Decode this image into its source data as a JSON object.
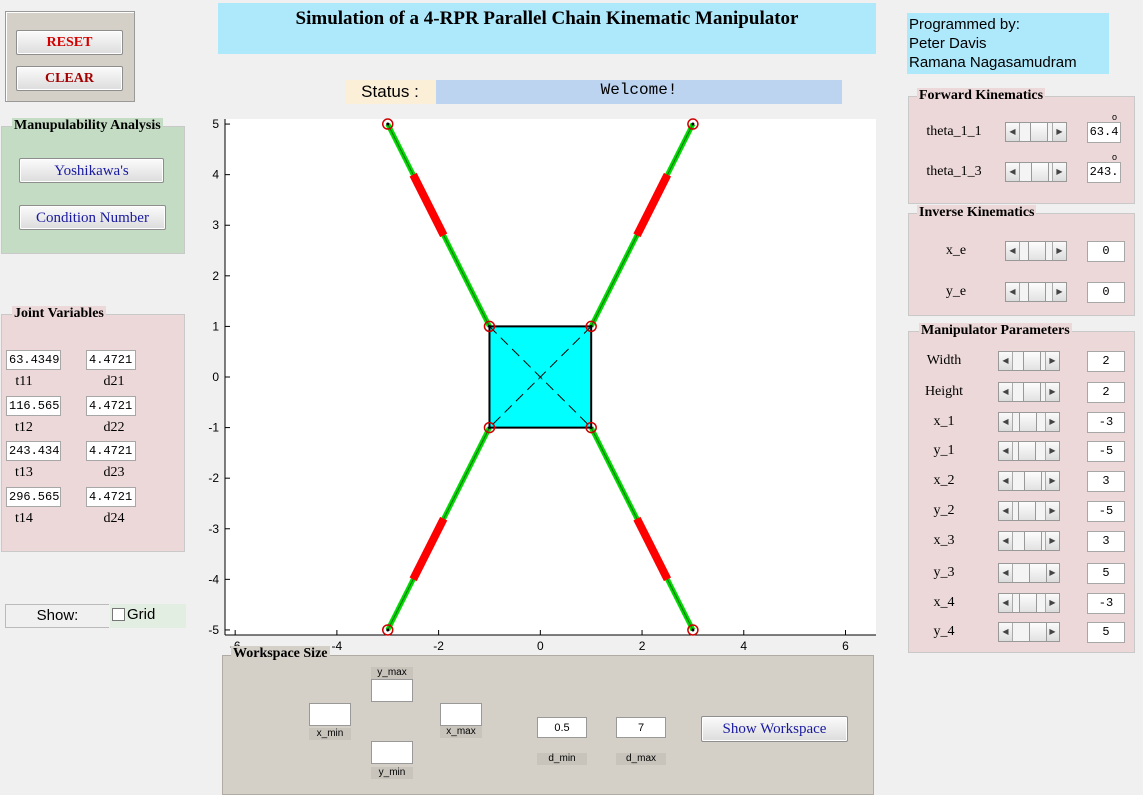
{
  "title": "Simulation of a 4-RPR Parallel Chain Kinematic Manipulator",
  "credits": [
    "Programmed by:",
    "Peter Davis",
    "Ramana Nagasamudram"
  ],
  "controls": {
    "reset": "RESET",
    "clear": "CLEAR"
  },
  "status": {
    "label": "Status :",
    "value": "Welcome!"
  },
  "manip_analysis": {
    "title": "Manupulability Analysis",
    "yoshikawa": "Yoshikawa's",
    "condition": "Condition Number"
  },
  "joint_vars": {
    "title": "Joint Variables",
    "rows": [
      {
        "t_val": "63.4349",
        "t_lbl": "t11",
        "d_val": "4.4721",
        "d_lbl": "d21"
      },
      {
        "t_val": "116.565",
        "t_lbl": "t12",
        "d_val": "4.4721",
        "d_lbl": "d22"
      },
      {
        "t_val": "243.434",
        "t_lbl": "t13",
        "d_val": "4.4721",
        "d_lbl": "d23"
      },
      {
        "t_val": "296.565",
        "t_lbl": "t14",
        "d_val": "4.4721",
        "d_lbl": "d24"
      }
    ]
  },
  "show": {
    "label": "Show:",
    "grid": "Grid",
    "grid_checked": false
  },
  "forward": {
    "title": "Forward Kinematics",
    "rows": [
      {
        "label": "theta_1_1",
        "value": "63.4",
        "unit": "o",
        "thumb": 0.55
      },
      {
        "label": "theta_1_3",
        "value": "243.",
        "unit": "o",
        "thumb": 0.6
      }
    ]
  },
  "inverse": {
    "title": "Inverse Kinematics",
    "rows": [
      {
        "label": "x_e",
        "value": "0",
        "thumb": 0.5
      },
      {
        "label": "y_e",
        "value": "0",
        "thumb": 0.5
      }
    ]
  },
  "params": {
    "title": "Manipulator Parameters",
    "rows": [
      {
        "label": "Width",
        "value": "2",
        "thumb": 0.55
      },
      {
        "label": "Height",
        "value": "2",
        "thumb": 0.55
      },
      {
        "label": "x_1",
        "value": "-3",
        "thumb": 0.45
      },
      {
        "label": "y_1",
        "value": "-5",
        "thumb": 0.4
      },
      {
        "label": "x_2",
        "value": "3",
        "thumb": 0.6
      },
      {
        "label": "y_2",
        "value": "-5",
        "thumb": 0.4
      },
      {
        "label": "x_3",
        "value": "3",
        "thumb": 0.6
      },
      {
        "label": "y_3",
        "value": "5",
        "thumb": 0.75
      },
      {
        "label": "x_4",
        "value": "-3",
        "thumb": 0.45
      },
      {
        "label": "y_4",
        "value": "5",
        "thumb": 0.75
      }
    ]
  },
  "workspace": {
    "title": "Workspace Size",
    "y_max": "y_max",
    "y_min": "y_min",
    "x_min": "x_min",
    "x_max": "x_max",
    "d_min": "d_min",
    "d_max": "d_max",
    "d_min_val": "0.5",
    "d_max_val": "7",
    "show_btn": "Show Workspace"
  },
  "colors": {
    "title_bg": "#aee8fb",
    "platform": "#00ffff",
    "link": "#00dd00",
    "actuator": "#ff0000",
    "joint": "#cc0000"
  },
  "plot": {
    "xlim": [
      -6.2,
      6.6
    ],
    "ylim": [
      -5.1,
      5.1
    ],
    "xticks": [
      -6,
      -4,
      -2,
      0,
      2,
      4,
      6
    ],
    "yticks": [
      5,
      4,
      3,
      2,
      1,
      0,
      -1,
      -2,
      -3,
      -4,
      -5
    ],
    "xtick_labels": [
      "-6",
      "-4",
      "-2",
      "0",
      "2",
      "4",
      "6"
    ],
    "ytick_labels": [
      "5",
      "4",
      "3",
      "2",
      "1",
      "0",
      "-1",
      "-2",
      "-3",
      "-4",
      "-5"
    ],
    "bases": [
      [
        -3,
        5
      ],
      [
        3,
        5
      ],
      [
        -3,
        -5
      ],
      [
        3,
        -5
      ]
    ],
    "platform": [
      [
        -1,
        1
      ],
      [
        1,
        1
      ],
      [
        1,
        -1
      ],
      [
        -1,
        -1
      ]
    ],
    "links": [
      {
        "base": [
          -3,
          5
        ],
        "end": [
          -1,
          1
        ]
      },
      {
        "base": [
          3,
          5
        ],
        "end": [
          1,
          1
        ]
      },
      {
        "base": [
          -3,
          -5
        ],
        "end": [
          -1,
          -1
        ]
      },
      {
        "base": [
          3,
          -5
        ],
        "end": [
          1,
          -1
        ]
      }
    ],
    "actuator_range": [
      0.25,
      0.55
    ]
  }
}
